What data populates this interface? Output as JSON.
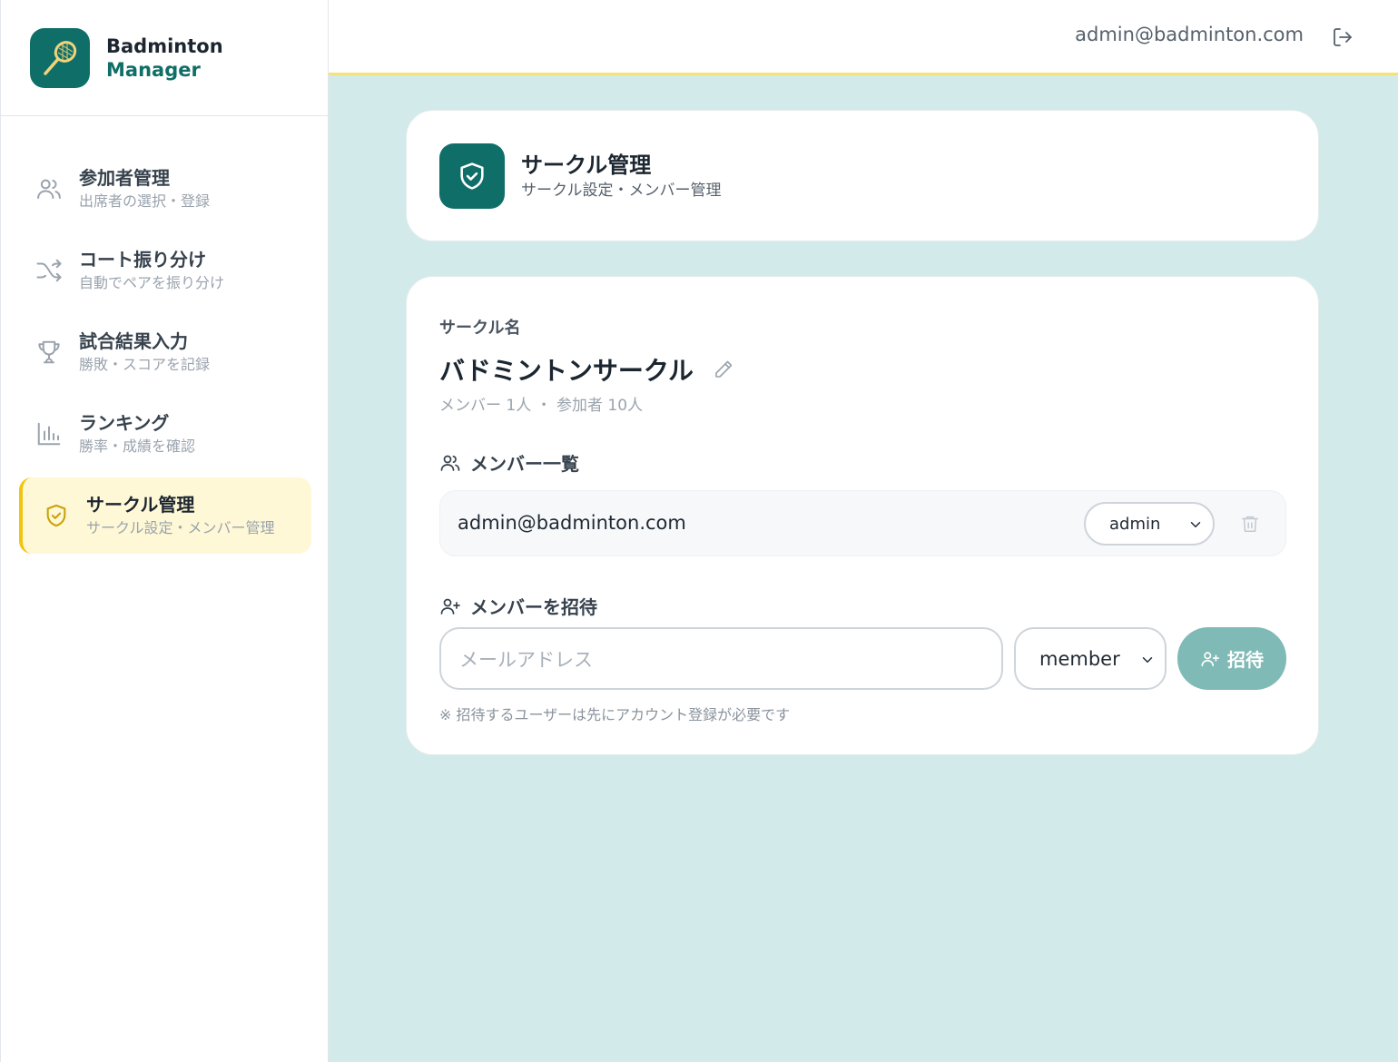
{
  "brand": {
    "name": "Badminton",
    "sub": "Manager"
  },
  "header": {
    "user_email": "admin@badminton.com"
  },
  "sidebar": {
    "items": [
      {
        "label": "参加者管理",
        "desc": "出席者の選択・登録",
        "icon": "users-icon"
      },
      {
        "label": "コート振り分け",
        "desc": "自動でペアを振り分け",
        "icon": "shuffle-icon"
      },
      {
        "label": "試合結果入力",
        "desc": "勝敗・スコアを記録",
        "icon": "trophy-icon"
      },
      {
        "label": "ランキング",
        "desc": "勝率・成績を確認",
        "icon": "bar-chart-icon"
      },
      {
        "label": "サークル管理",
        "desc": "サークル設定・メンバー管理",
        "icon": "shield-check-icon",
        "active": true
      }
    ]
  },
  "page_header": {
    "title": "サークル管理",
    "subtitle": "サークル設定・メンバー管理"
  },
  "circle": {
    "section_label": "サークル名",
    "name": "バドミントンサークル",
    "stats": "メンバー 1人 ・ 参加者 10人"
  },
  "members": {
    "heading": "メンバー一覧",
    "rows": [
      {
        "email": "admin@badminton.com",
        "role": "admin"
      }
    ]
  },
  "invite": {
    "heading": "メンバーを招待",
    "email_placeholder": "メールアドレス",
    "role_selected": "member",
    "button_label": "招待",
    "note": "※ 招待するユーザーは先にアカウント登録が必要です"
  },
  "colors": {
    "primary": "#0f6f68",
    "accent_yellow": "#f1c40f",
    "active_bg": "#fff8d6",
    "content_bg": "#d2eae9",
    "invite_button": "#80bab6"
  }
}
